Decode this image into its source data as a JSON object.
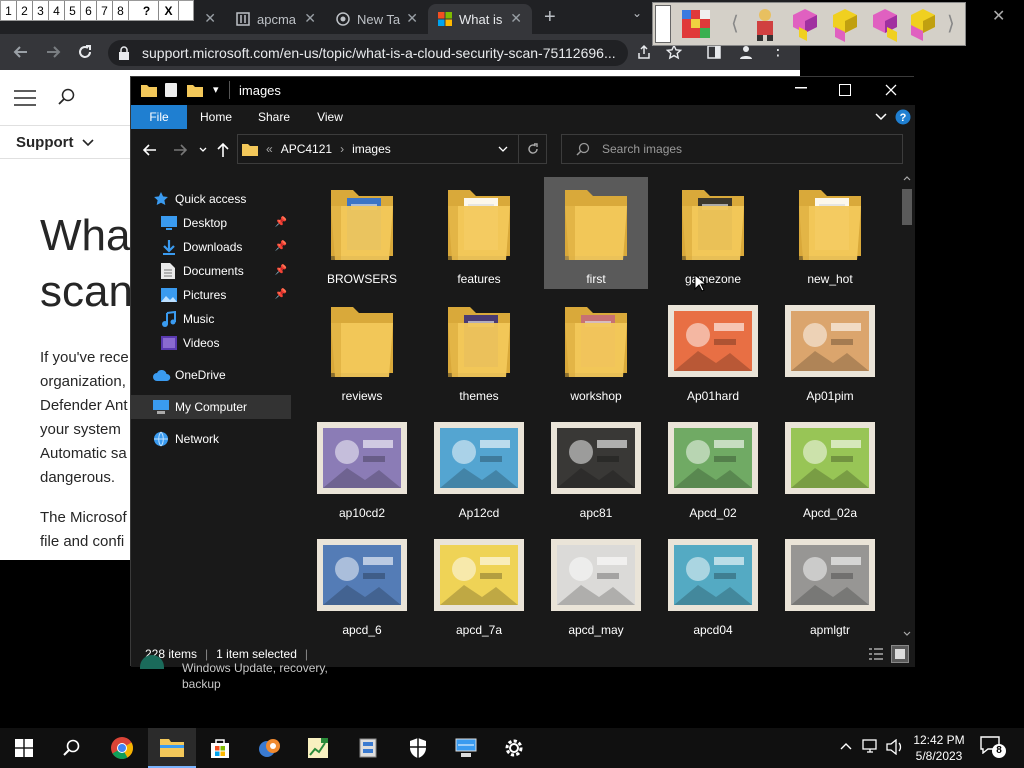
{
  "gallery": {
    "cells": [
      "1",
      "2",
      "3",
      "4",
      "5",
      "6",
      "7",
      "8",
      "?",
      "X"
    ]
  },
  "browser": {
    "tabs": [
      {
        "label": ""
      },
      {
        "label": "apcma"
      },
      {
        "label": "New Ta"
      },
      {
        "label": "What is"
      }
    ],
    "new_tab": "+",
    "url": "support.microsoft.com/en-us/topic/what-is-a-cloud-security-scan-75112696...",
    "support_label": "Support",
    "page_title_1": "Wha",
    "page_title_2": "scan",
    "page_lines": [
      "If you've rece",
      "organization,",
      "Defender Ant",
      "your system",
      "Automatic sa",
      "dangerous.",
      "",
      "The Microsof",
      "file and confi"
    ],
    "window_close": "✕"
  },
  "explorer": {
    "title": "images",
    "ribbon_tabs": [
      "File",
      "Home",
      "Share",
      "View"
    ],
    "breadcrumb_prefix": "«",
    "breadcrumb": [
      "APC4121",
      "images"
    ],
    "search_placeholder": "Search images",
    "nav": [
      {
        "label": "Quick access",
        "icon": "star-icon",
        "indent": 0,
        "pin": false
      },
      {
        "label": "Desktop",
        "icon": "desktop-icon",
        "indent": 1,
        "pin": true
      },
      {
        "label": "Downloads",
        "icon": "download-icon",
        "indent": 1,
        "pin": true
      },
      {
        "label": "Documents",
        "icon": "document-icon",
        "indent": 1,
        "pin": true
      },
      {
        "label": "Pictures",
        "icon": "picture-icon",
        "indent": 1,
        "pin": true
      },
      {
        "label": "Music",
        "icon": "music-icon",
        "indent": 1,
        "pin": false
      },
      {
        "label": "Videos",
        "icon": "video-icon",
        "indent": 1,
        "pin": false
      },
      {
        "label": "OneDrive",
        "icon": "cloud-icon",
        "indent": 0,
        "pin": false
      },
      {
        "label": "My Computer",
        "icon": "computer-icon",
        "indent": 0,
        "pin": false
      },
      {
        "label": "Network",
        "icon": "network-icon",
        "indent": 0,
        "pin": false
      }
    ],
    "items": [
      {
        "label": "BROWSERS",
        "kind": "folder",
        "accent": "#2a6fd6"
      },
      {
        "label": "features",
        "kind": "folder",
        "accent": "#ffffff"
      },
      {
        "label": "first",
        "kind": "folder",
        "accent": "",
        "selected": true
      },
      {
        "label": "gamezone",
        "kind": "folder",
        "accent": "#2b2b2b"
      },
      {
        "label": "new_hot",
        "kind": "folder",
        "accent": "#ffffff"
      },
      {
        "label": "reviews",
        "kind": "folder",
        "accent": ""
      },
      {
        "label": "themes",
        "kind": "folder",
        "accent": "#3a2f7a"
      },
      {
        "label": "workshop",
        "kind": "folder",
        "accent": "#c46a7a"
      },
      {
        "label": "Ap01hard",
        "kind": "image",
        "accent": "#e85a2a"
      },
      {
        "label": "Ap01pim",
        "kind": "image",
        "accent": "#d89a5a"
      },
      {
        "label": "ap10cd2",
        "kind": "image",
        "accent": "#7a6ab0"
      },
      {
        "label": "Ap12cd",
        "kind": "image",
        "accent": "#3a9ad0"
      },
      {
        "label": "apc81",
        "kind": "image",
        "accent": "#1a1a1a"
      },
      {
        "label": "Apcd_02",
        "kind": "image",
        "accent": "#5aa050"
      },
      {
        "label": "Apcd_02a",
        "kind": "image",
        "accent": "#8ac040"
      },
      {
        "label": "apcd_6",
        "kind": "image",
        "accent": "#3a6ab0"
      },
      {
        "label": "apcd_7a",
        "kind": "image",
        "accent": "#f0d040"
      },
      {
        "label": "apcd_may",
        "kind": "image",
        "accent": "#d8d8d8"
      },
      {
        "label": "apcd04",
        "kind": "image",
        "accent": "#3aa0c0"
      },
      {
        "label": "apmlgtr",
        "kind": "image",
        "accent": "#888888"
      }
    ],
    "status_count": "228 items",
    "status_selected": "1 item selected",
    "below_text_1": "Windows Update, recovery,",
    "below_text_2": "backup"
  },
  "taskbar": {
    "time": "12:42 PM",
    "date": "5/8/2023",
    "notification_count": "8"
  },
  "colors": {
    "folder": "#f3c85a",
    "folder_dark": "#d9a93a",
    "accent_blue": "#2a8bd8",
    "file_tab": "#1f7fd1"
  }
}
